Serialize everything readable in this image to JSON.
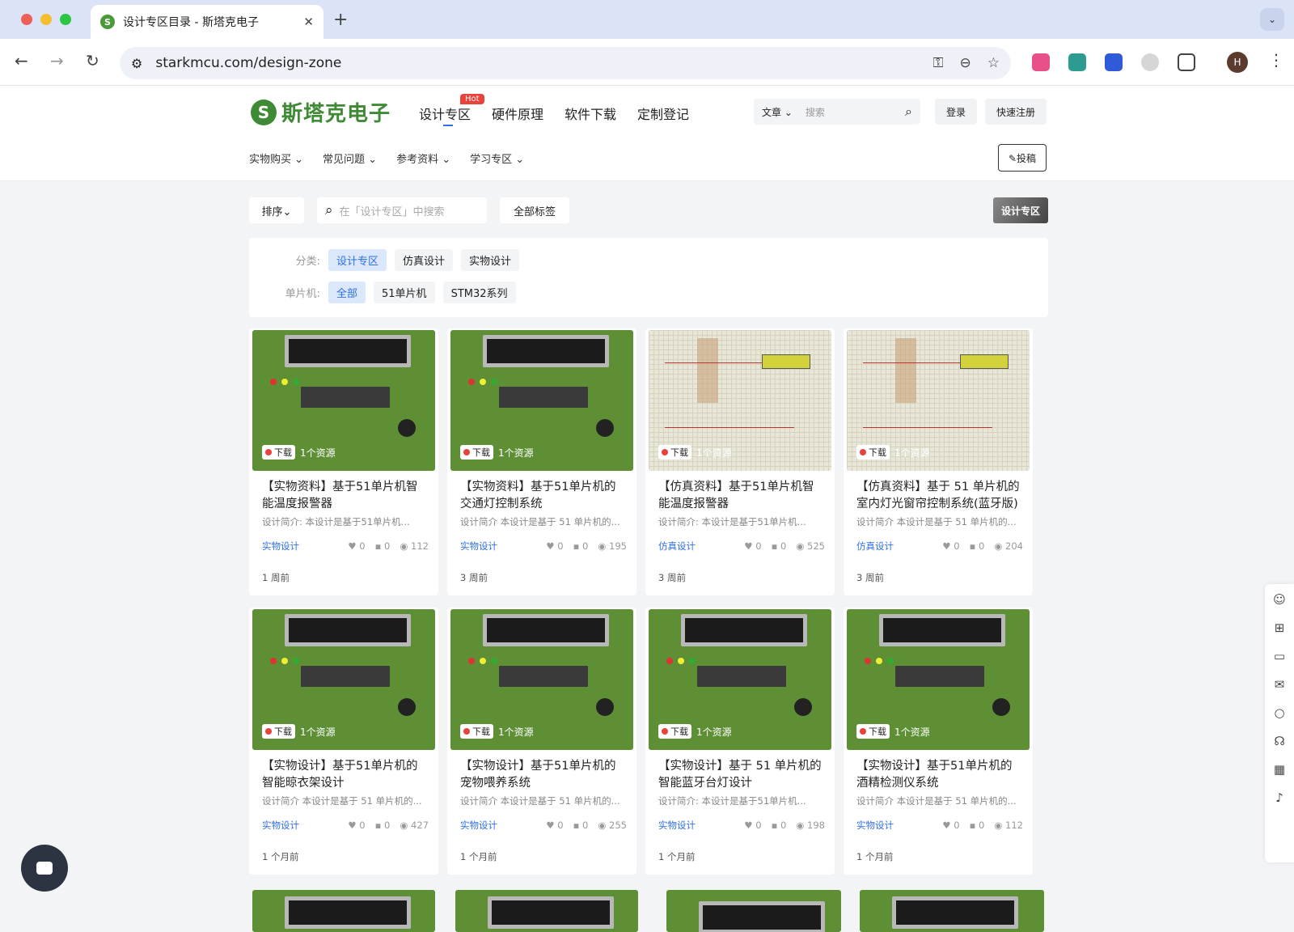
{
  "browser": {
    "tab_title": "设计专区目录 - 斯塔克电子",
    "favicon": "S",
    "url": "starkmcu.com/design-zone",
    "avatar": "H",
    "tab_close": "✕",
    "new_tab": "+",
    "tab_menu": "⌄",
    "back": "←",
    "forward": "→",
    "reload": "↻",
    "site_info": "⚙",
    "key": "⚿",
    "zoom": "⊖",
    "star": "☆",
    "kebab": "⋮"
  },
  "site": {
    "logo_mark": "S",
    "logo_text": "斯塔克电子",
    "nav": [
      "设计专区",
      "硬件原理",
      "软件下载",
      "定制登记"
    ],
    "hot": "Hot",
    "search_select": "文章 ⌄",
    "search_placeholder": "搜索",
    "login": "登录",
    "register": "快速注册",
    "subnav": [
      "实物购买 ⌄",
      "常见问题 ⌄",
      "参考资料 ⌄",
      "学习专区 ⌄"
    ],
    "post": "✎投稿"
  },
  "filter": {
    "sort": "排序⌄",
    "search_placeholder": "在「设计专区」中搜索",
    "all_tags": "全部标签",
    "badge": "设计专区",
    "cat_label": "分类:",
    "cats": [
      "设计专区",
      "仿真设计",
      "实物设计"
    ],
    "mcu_label": "单片机:",
    "mcus": [
      "全部",
      "51单片机",
      "STM32系列"
    ]
  },
  "download_label": "下载",
  "resource_label": "1个资源",
  "cards": [
    {
      "title": "【实物资料】基于51单片机智能温度报警器",
      "desc": "设计简介:  本设计是基于51单片机...",
      "tag": "实物设计",
      "likes": "0",
      "comments": "0",
      "views": "112",
      "time": "1 周前",
      "thumb": "pcb"
    },
    {
      "title": "【实物资料】基于51单片机的交通灯控制系统",
      "desc": "设计简介 本设计是基于 51 单片机的...",
      "tag": "实物设计",
      "likes": "0",
      "comments": "0",
      "views": "195",
      "time": "3 周前",
      "thumb": "pcb"
    },
    {
      "title": "【仿真资料】基于51单片机智能温度报警器",
      "desc": "设计简介:  本设计是基于51单片机...",
      "tag": "仿真设计",
      "likes": "0",
      "comments": "0",
      "views": "525",
      "time": "3 周前",
      "thumb": "sch"
    },
    {
      "title": "【仿真资料】基于 51 单片机的室内灯光窗帘控制系统(蓝牙版)",
      "desc": "设计简介 本设计是基于 51 单片机的...",
      "tag": "仿真设计",
      "likes": "0",
      "comments": "0",
      "views": "204",
      "time": "3 周前",
      "thumb": "sch"
    },
    {
      "title": "【实物设计】基于51单片机的智能晾衣架设计",
      "desc": "设计简介 本设计是基于 51 单片机的...",
      "tag": "实物设计",
      "likes": "0",
      "comments": "0",
      "views": "427",
      "time": "1 个月前",
      "thumb": "pcb"
    },
    {
      "title": "【实物设计】基于51单片机的宠物喂养系统",
      "desc": "设计简介 本设计是基于 51 单片机的...",
      "tag": "实物设计",
      "likes": "0",
      "comments": "0",
      "views": "255",
      "time": "1 个月前",
      "thumb": "pcb"
    },
    {
      "title": "【实物设计】基于 51 单片机的智能蓝牙台灯设计",
      "desc": "设计简介:  本设计是基于51单片机...",
      "tag": "实物设计",
      "likes": "0",
      "comments": "0",
      "views": "198",
      "time": "1 个月前",
      "thumb": "pcb"
    },
    {
      "title": "【实物设计】基于51单片机的酒精检测仪系统",
      "desc": "设计简介 本设计是基于 51 单片机的...",
      "tag": "实物设计",
      "likes": "0",
      "comments": "0",
      "views": "112",
      "time": "1 个月前",
      "thumb": "pcb"
    }
  ],
  "icons": {
    "like": "♥",
    "comment": "▪",
    "view": "◉",
    "search": "⌕"
  },
  "sidebar_icons": [
    "user-icon",
    "cart-icon",
    "coupon-icon",
    "mail-icon",
    "search-icon",
    "service-icon",
    "qrcode-icon",
    "bell-icon"
  ]
}
